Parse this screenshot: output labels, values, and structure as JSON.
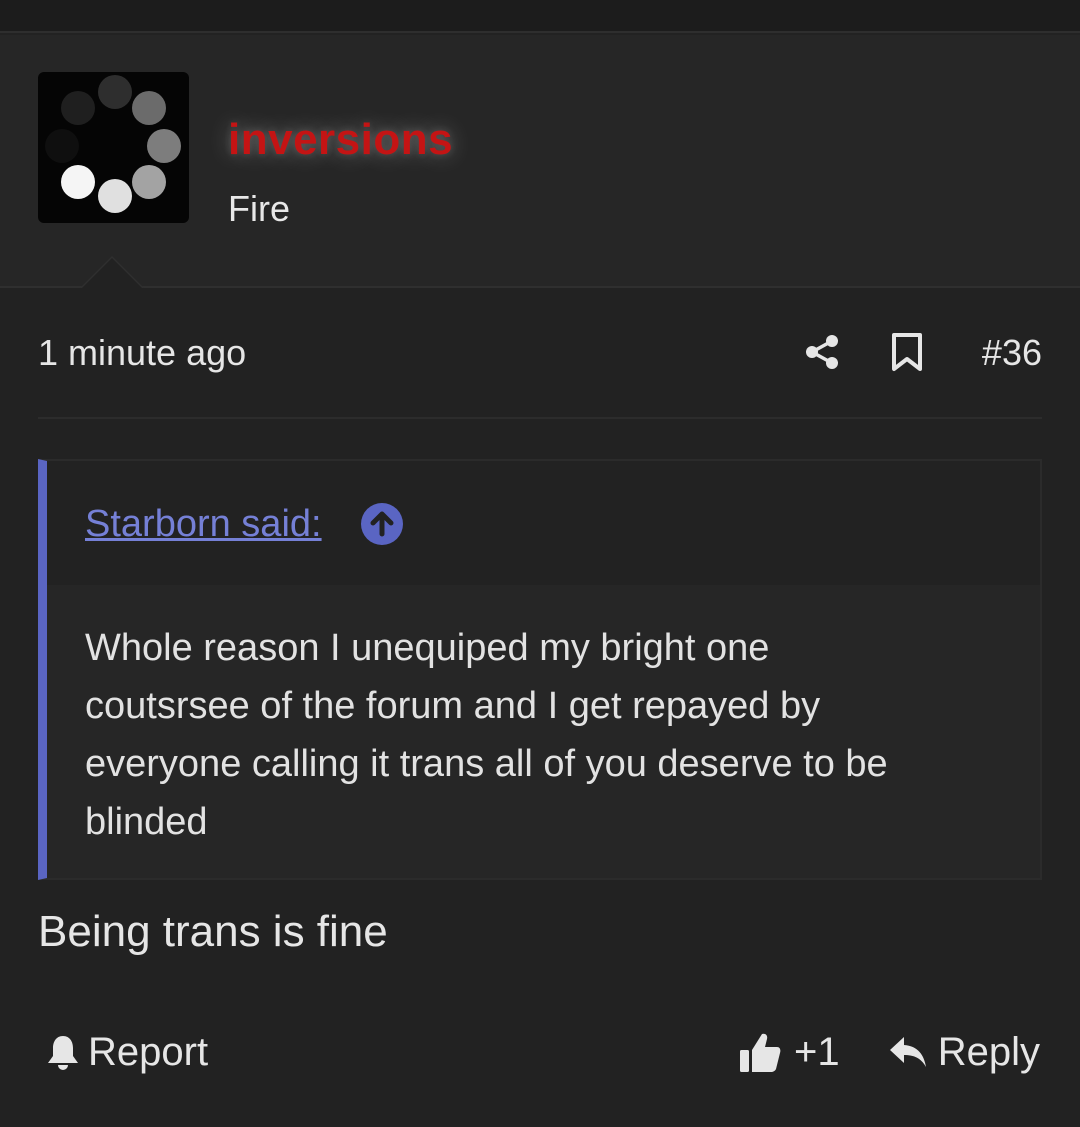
{
  "user": {
    "username": "inversions",
    "title": "Fire",
    "avatar_icon": "loading-spinner-dots",
    "username_color": "#c41414"
  },
  "post": {
    "timestamp": "1 minute ago",
    "post_number": "#36",
    "share_icon": "share-icon",
    "bookmark_icon": "bookmark-icon",
    "message": "Being trans is fine"
  },
  "quote": {
    "author_label": "Starborn said:",
    "jump_icon": "arrow-up-circle-icon",
    "lines": [
      "Whole reason I unequiped my bright one",
      "coutsrsee of the forum and I get repayed by",
      "everyone calling it trans all of you deserve to be",
      "blinded"
    ],
    "accent_color": "#5a65c3"
  },
  "actions": {
    "report_label": "Report",
    "like_label": "+1",
    "reply_label": "Reply"
  }
}
